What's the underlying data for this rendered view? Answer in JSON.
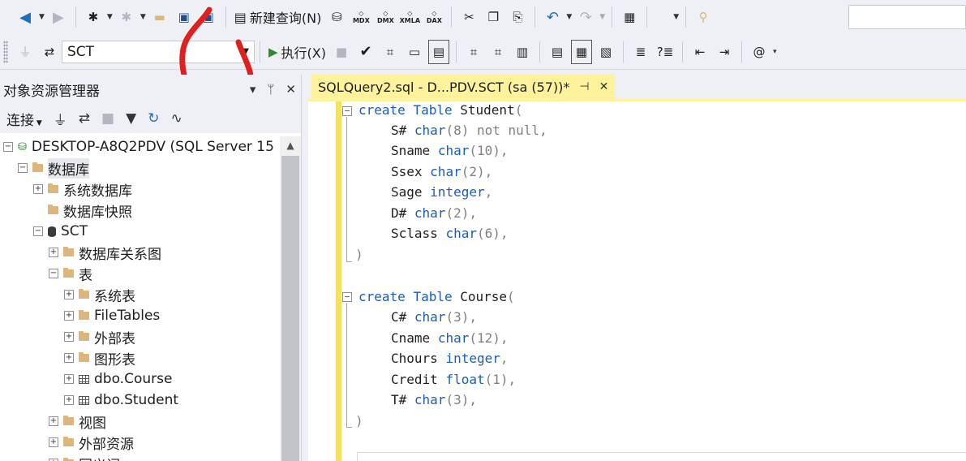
{
  "toolbar": {
    "new_query_label": "新建查询(N)",
    "mdx_label": "MDX",
    "dmx_label": "DMX",
    "xmla_label": "XMLA",
    "dax_label": "DAX",
    "database_selected": "SCT",
    "execute_label": "执行(X)"
  },
  "object_explorer": {
    "title": "对象资源管理器",
    "connect_label": "连接",
    "tree": [
      {
        "label": "DESKTOP-A8Q2PDV (SQL Server 15"
      },
      {
        "label": "数据库"
      },
      {
        "label": "系统数据库"
      },
      {
        "label": "数据库快照"
      },
      {
        "label": "SCT"
      },
      {
        "label": "数据库关系图"
      },
      {
        "label": "表"
      },
      {
        "label": "系统表"
      },
      {
        "label": "FileTables"
      },
      {
        "label": "外部表"
      },
      {
        "label": "图形表"
      },
      {
        "label": "dbo.Course"
      },
      {
        "label": "dbo.Student"
      },
      {
        "label": "视图"
      },
      {
        "label": "外部资源"
      },
      {
        "label": "同义词"
      }
    ]
  },
  "editor": {
    "tab_title": "SQLQuery2.sql - D...PDV.SCT (sa (57))*",
    "code": {
      "l1": {
        "kw1": "create",
        "kw2": "Table",
        "name": "Student",
        "open": "("
      },
      "l2": {
        "id": "S#",
        "type": "char",
        "args": "(8)",
        "extra": " not null",
        "end": ","
      },
      "l3": {
        "id": "Sname",
        "type": "char",
        "args": "(10)",
        "end": ","
      },
      "l4": {
        "id": "Ssex",
        "type": "char",
        "args": "(2)",
        "end": ","
      },
      "l5": {
        "id": "Sage",
        "type": "integer",
        "end": ","
      },
      "l6": {
        "id": "D#",
        "type": "char",
        "args": "(2)",
        "end": ","
      },
      "l7": {
        "id": "Sclass",
        "type": "char",
        "args": "(6)",
        "end": ","
      },
      "l8": {
        "close": ")"
      },
      "l10": {
        "kw1": "create",
        "kw2": "Table",
        "name": "Course",
        "open": "("
      },
      "l11": {
        "id": "C#",
        "type": "char",
        "args": "(3)",
        "end": ","
      },
      "l12": {
        "id": "Cname",
        "type": "char",
        "args": "(12)",
        "end": ","
      },
      "l13": {
        "id": "Chours",
        "type": "integer",
        "end": ","
      },
      "l14": {
        "id": "Credit",
        "type": "float",
        "args": "(1)",
        "end": ","
      },
      "l15": {
        "id": "T#",
        "type": "char",
        "args": "(3)",
        "end": ","
      },
      "l16": {
        "close": ")"
      }
    }
  },
  "colors": {
    "keyword": "#1a5cb8",
    "tab_active": "#fff29d",
    "change_bar": "#f3e260",
    "annotation": "#e0201e"
  }
}
